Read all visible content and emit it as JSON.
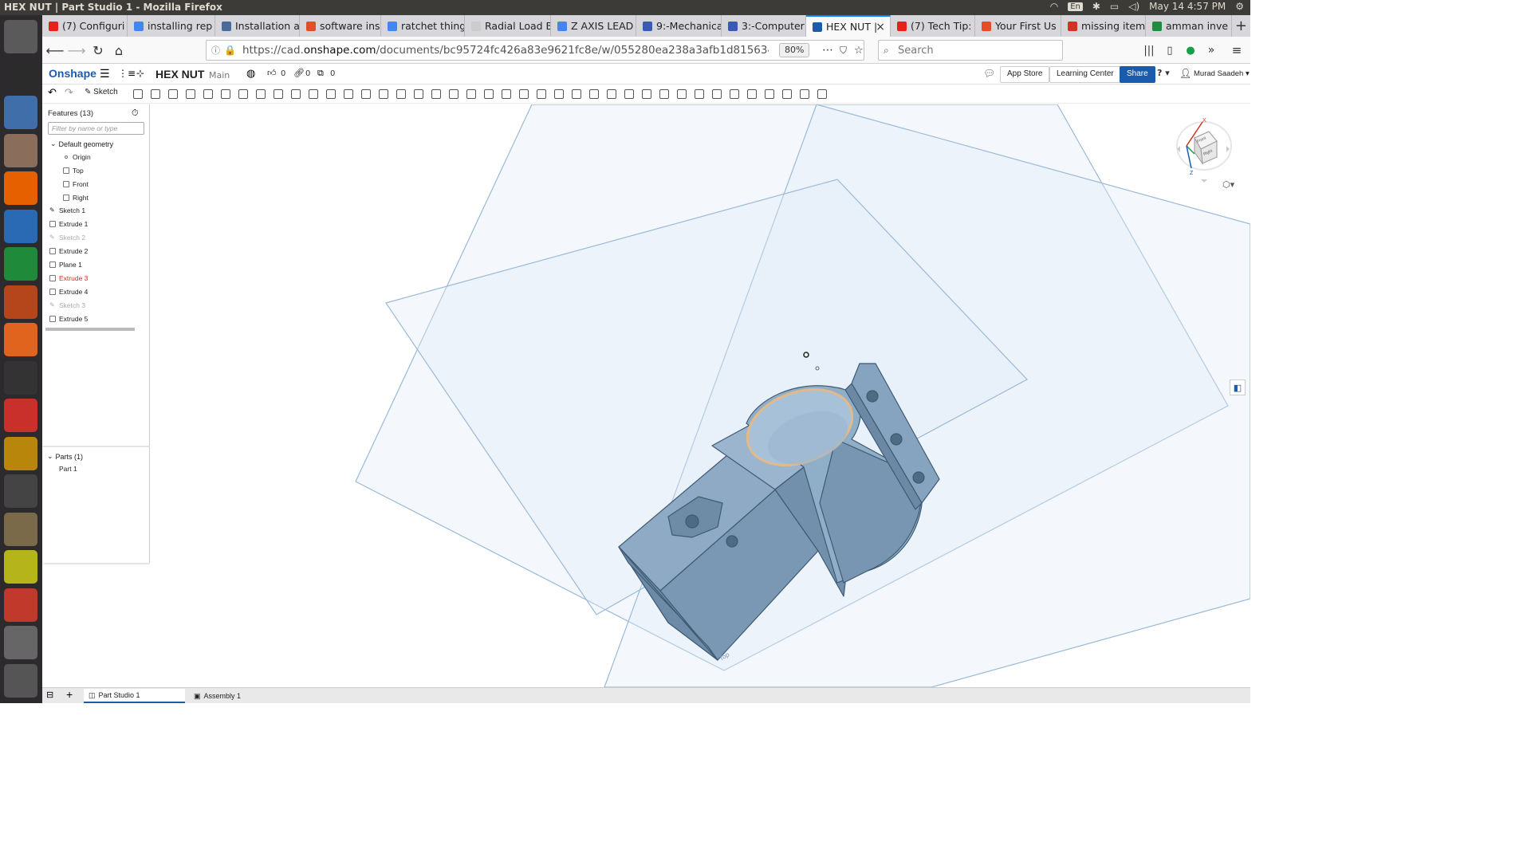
{
  "window": {
    "title": "HEX NUT | Part Studio 1 - Mozilla Firefox"
  },
  "system_tray": {
    "language": "En",
    "datetime": "May 14  4:57 PM"
  },
  "launcher": {
    "items": [
      {
        "name": "ubuntu-dash-icon",
        "color": "#5a5a5a"
      },
      {
        "name": "terminal-icon",
        "color": "#2b2b2b"
      },
      {
        "name": "3d-app-icon",
        "color": "#3f6ea8"
      },
      {
        "name": "files-icon",
        "color": "#8a6d5a"
      },
      {
        "name": "firefox-icon",
        "color": "#e66000"
      },
      {
        "name": "writer-icon",
        "color": "#2a6ab5"
      },
      {
        "name": "calc-icon",
        "color": "#1f8a3a"
      },
      {
        "name": "impress-icon",
        "color": "#b5451b"
      },
      {
        "name": "software-center-icon",
        "color": "#e0641e"
      },
      {
        "name": "amazon-icon",
        "color": "#333333"
      },
      {
        "name": "settings-icon",
        "color": "#c9302c"
      },
      {
        "name": "schematic-icon",
        "color": "#b8860b"
      },
      {
        "name": "inkscape-icon",
        "color": "#444444"
      },
      {
        "name": "gimp-icon",
        "color": "#7a6a4a"
      },
      {
        "name": "freecad-icon",
        "color": "#b5b51b"
      },
      {
        "name": "pdf-viewer-icon",
        "color": "#c0392b"
      },
      {
        "name": "camera-icon",
        "color": "#666666"
      },
      {
        "name": "drive-icon",
        "color": "#555555"
      }
    ]
  },
  "browser": {
    "tabs": [
      {
        "label": "(7) Configuri",
        "fav_color": "#e62117"
      },
      {
        "label": "installing rep",
        "fav_color": "#4285f4"
      },
      {
        "label": "Installation a",
        "fav_color": "#4a6a9a"
      },
      {
        "label": "software ins",
        "fav_color": "#e44d26"
      },
      {
        "label": "ratchet thing",
        "fav_color": "#4285f4"
      },
      {
        "label": "Radial Load Bea",
        "fav_color": "#cccccc"
      },
      {
        "label": "Z AXIS LEAD",
        "fav_color": "#4285f4"
      },
      {
        "label": "9:-Mechanica",
        "fav_color": "#3a5ab8"
      },
      {
        "label": "3:-Computer",
        "fav_color": "#3a5ab8"
      },
      {
        "label": "HEX NUT |",
        "fav_color": "#1a5bab",
        "active": true
      },
      {
        "label": "(7) Tech Tip:",
        "fav_color": "#e62117"
      },
      {
        "label": "Your First Us",
        "fav_color": "#e44d26"
      },
      {
        "label": "missing item",
        "fav_color": "#d93025"
      },
      {
        "label": "amman inve",
        "fav_color": "#1e8e3e"
      }
    ],
    "url_prefix": "https://cad.",
    "url_domain": "onshape.com",
    "url_rest": "/documents/bc95724fc426a83e9621fc8e/w/055280ea238a3afb1d815634/e/5e5205e784eb",
    "zoom": "80%",
    "search_placeholder": "Search"
  },
  "onshape": {
    "logo": "Onshape",
    "document_name": "HEX NUT",
    "branch": "Main",
    "likes": "0",
    "links": "0",
    "copies": "0",
    "app_store": "App Store",
    "learning_center": "Learning Center",
    "share": "Share",
    "help": "?",
    "user": "Murad Saadeh",
    "sketch_label": "Sketch"
  },
  "features": {
    "title": "Features (13)",
    "filter_placeholder": "Filter by name or type",
    "default_geometry": "Default geometry",
    "geometry_items": [
      "Origin",
      "Top",
      "Front",
      "Right"
    ],
    "items": [
      {
        "label": "Sketch 1",
        "state": "normal"
      },
      {
        "label": "Extrude 1",
        "state": "normal"
      },
      {
        "label": "Sketch 2",
        "state": "dim"
      },
      {
        "label": "Extrude 2",
        "state": "normal"
      },
      {
        "label": "Plane 1",
        "state": "normal"
      },
      {
        "label": "Extrude 3",
        "state": "error"
      },
      {
        "label": "Extrude 4",
        "state": "normal"
      },
      {
        "label": "Sketch 3",
        "state": "dim"
      },
      {
        "label": "Extrude 5",
        "state": "normal"
      }
    ],
    "parts_title": "Parts (1)",
    "parts": [
      "Part 1"
    ]
  },
  "viewcube": {
    "front_label": "Front",
    "right_label": "Right",
    "x": "X",
    "z": "Z"
  },
  "viewport": {
    "plane_label": "Top"
  },
  "bottom_tabs": [
    {
      "label": "Part Studio 1",
      "active": true
    },
    {
      "label": "Assembly 1",
      "active": false
    }
  ],
  "colors": {
    "brand": "#1a5bab",
    "part": "#7d9db9",
    "plane": "#a9c4e0",
    "highlight": "#e4b98a",
    "error": "#d0301e"
  }
}
